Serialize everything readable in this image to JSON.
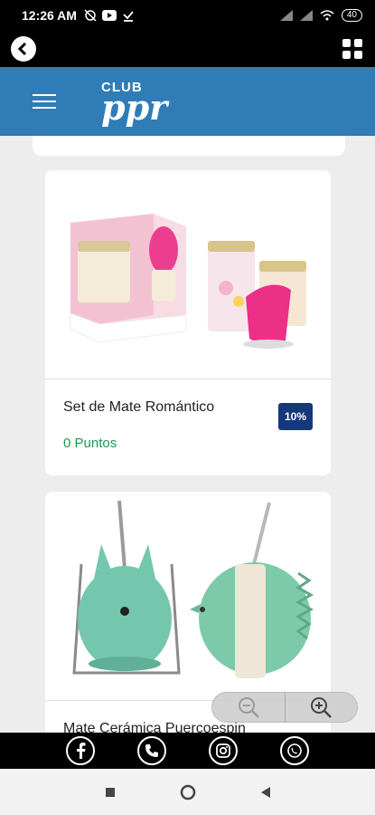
{
  "status_bar": {
    "time": "12:26 AM",
    "battery": "40"
  },
  "header": {
    "logo_top": "CLUB",
    "logo_main": "ppr"
  },
  "products": [
    {
      "name": "Set de Mate Romántico",
      "points": "0 Puntos",
      "discount": "10%"
    },
    {
      "name": "Mate Cerámica Puercoespin"
    }
  ],
  "icons": {
    "back": "back-arrow-icon",
    "grid": "grid-icon",
    "menu": "hamburger-icon",
    "zoom_out": "zoom-out-icon",
    "zoom_in": "zoom-in-icon",
    "facebook": "facebook-icon",
    "phone": "phone-icon",
    "instagram": "instagram-icon",
    "whatsapp": "whatsapp-icon"
  },
  "colors": {
    "header_blue": "#2f7cb6",
    "points_green": "#1b9a4b",
    "badge_navy": "#15387a"
  }
}
